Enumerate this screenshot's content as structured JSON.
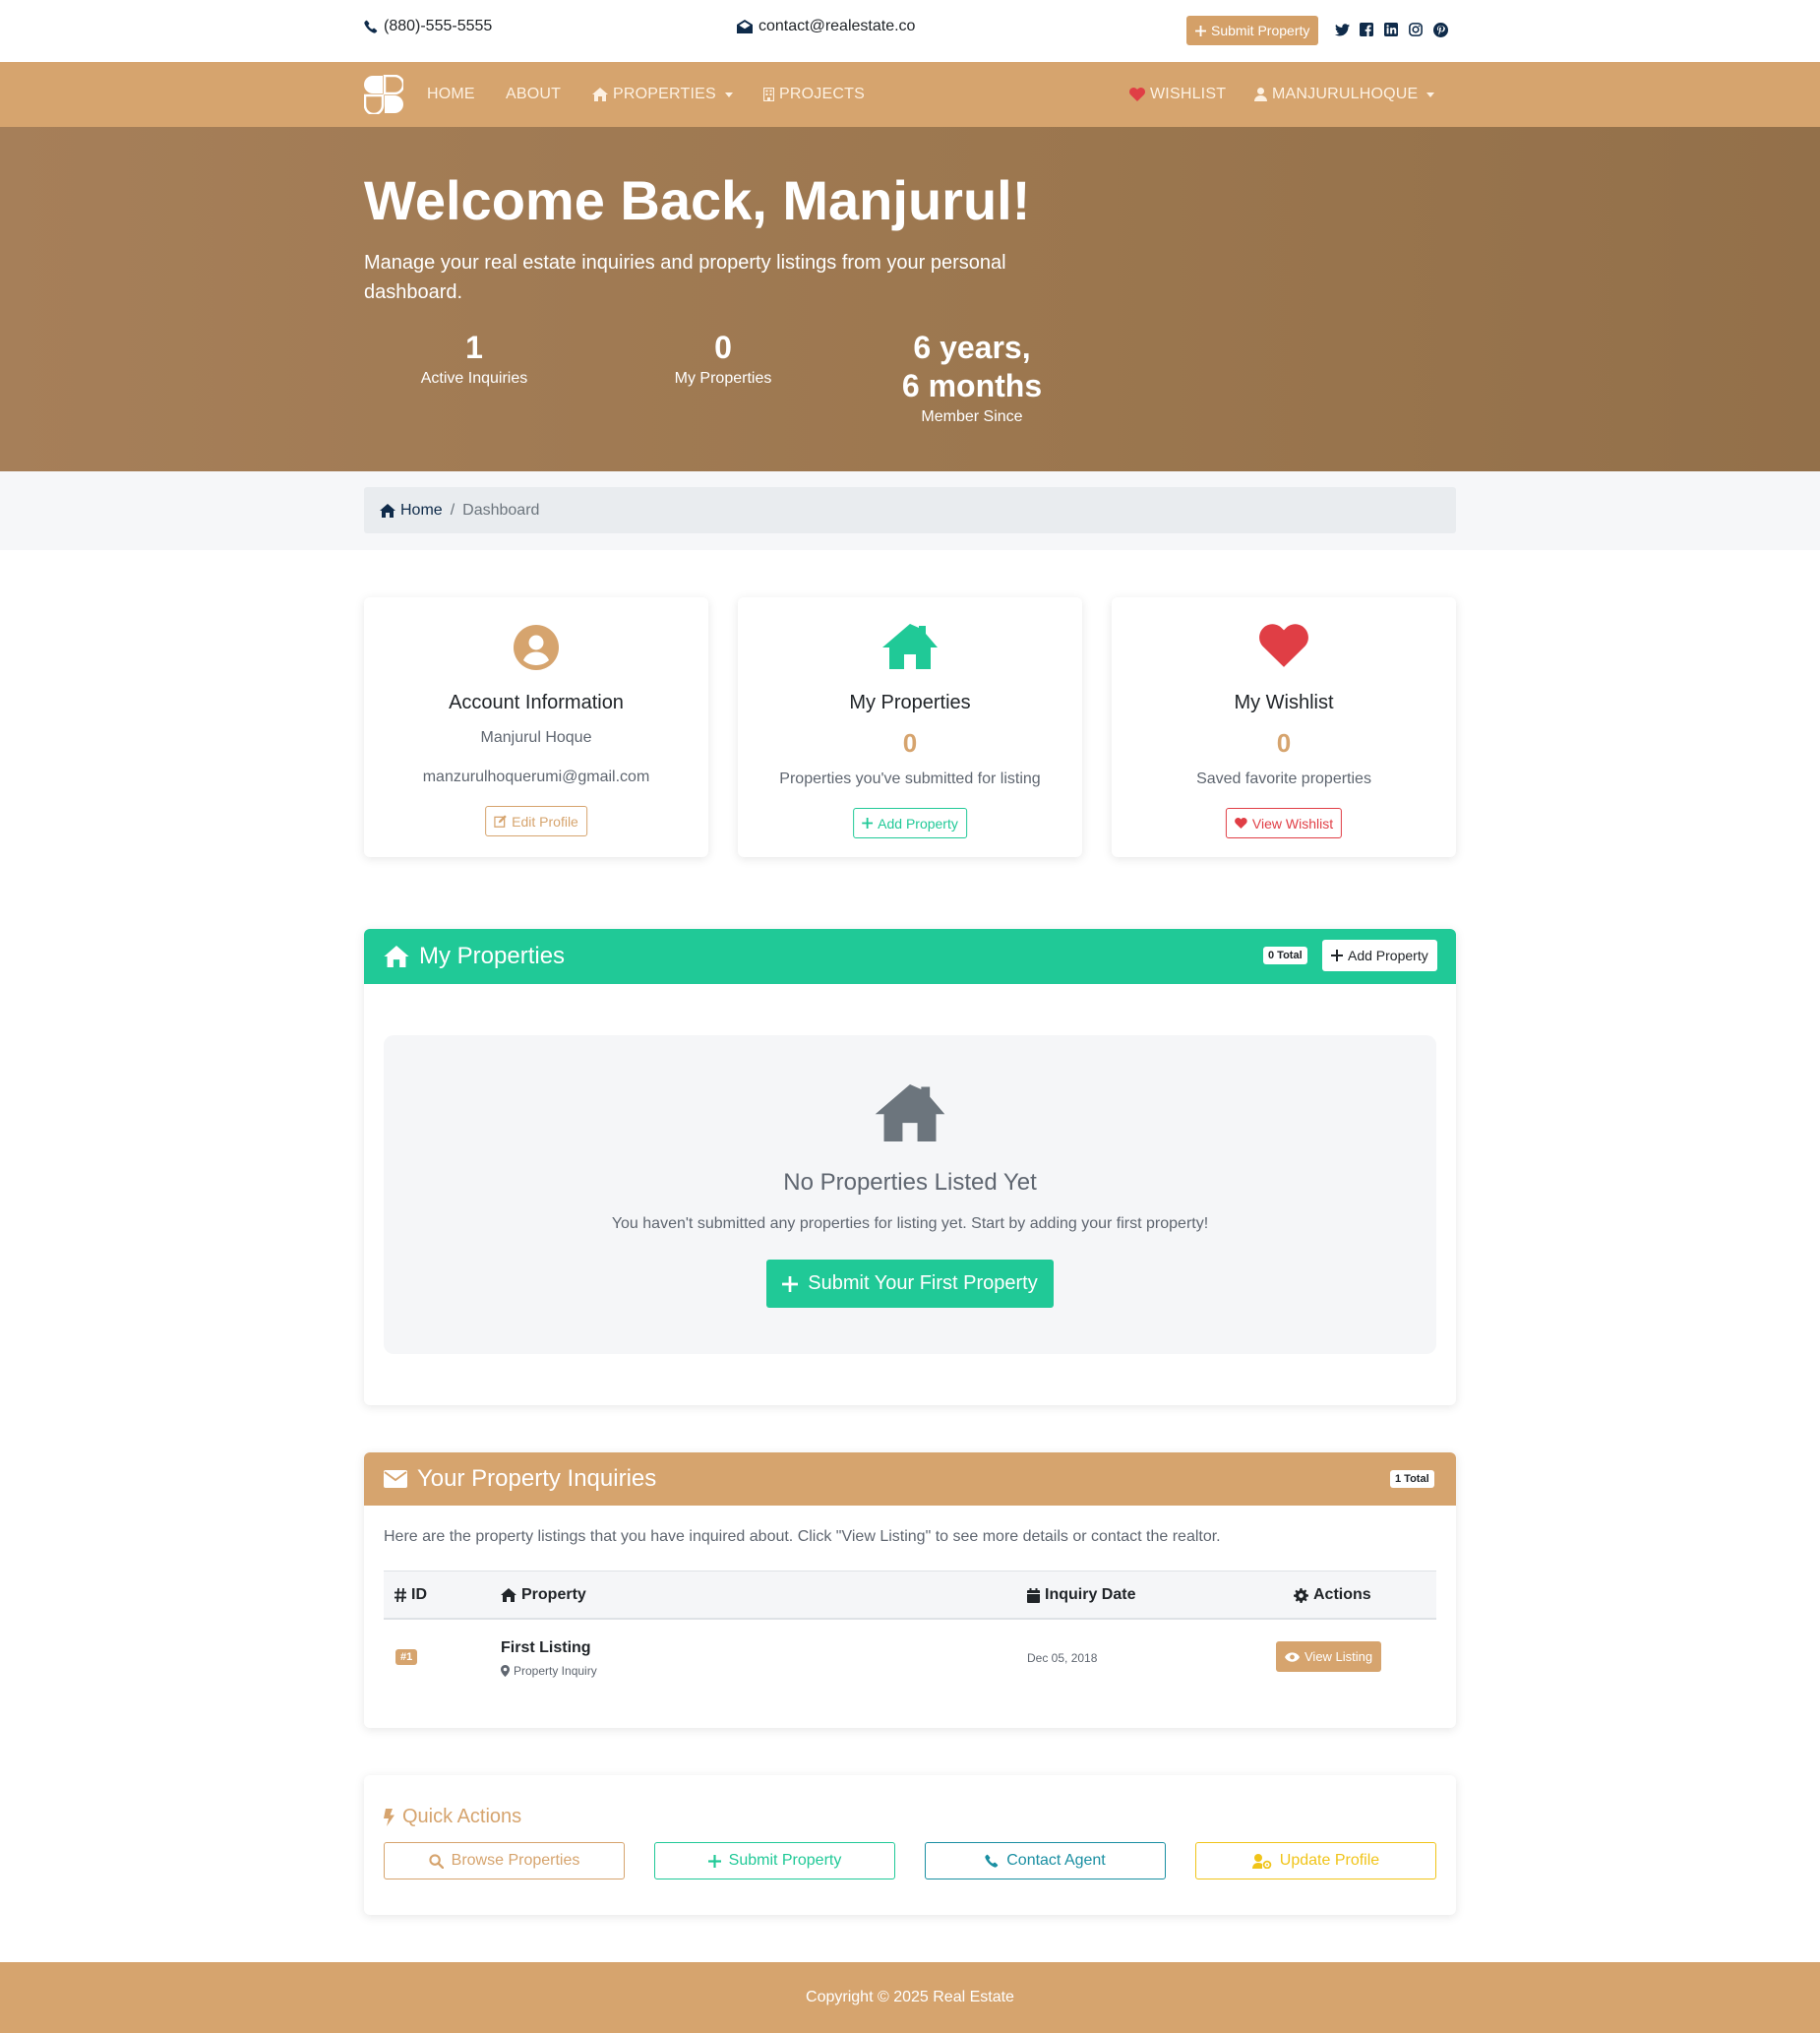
{
  "topbar": {
    "phone": "(880)-555-5555",
    "email": "contact@realestate.co",
    "submit_label": "Submit Property",
    "social_icons": [
      "twitter-icon",
      "facebook-icon",
      "linkedin-icon",
      "instagram-icon",
      "pinterest-icon"
    ]
  },
  "nav": {
    "home": "HOME",
    "about": "ABOUT",
    "properties": "PROPERTIES",
    "projects": "PROJECTS",
    "wishlist": "WISHLIST",
    "user": "MANJURULHOQUE"
  },
  "hero": {
    "title": "Welcome Back, Manjurul!",
    "subtitle": "Manage your real estate inquiries and property listings from your personal dashboard.",
    "stats": [
      {
        "value": "1",
        "label": "Active Inquiries"
      },
      {
        "value": "0",
        "label": "My Properties"
      },
      {
        "value_line1": "6 years,",
        "value_line2": "6 months",
        "label": "Member Since"
      }
    ]
  },
  "breadcrumb": {
    "home": "Home",
    "current": "Dashboard"
  },
  "cards": {
    "account": {
      "title": "Account Information",
      "name": "Manjurul Hoque",
      "email": "manzurulhoquerumi@gmail.com",
      "button": "Edit Profile"
    },
    "properties": {
      "title": "My Properties",
      "count": "0",
      "desc": "Properties you've submitted for listing",
      "button": "Add Property"
    },
    "wishlist": {
      "title": "My Wishlist",
      "count": "0",
      "desc": "Saved favorite properties",
      "button": "View Wishlist"
    }
  },
  "my_properties": {
    "title": "My Properties",
    "total_badge": "0 Total",
    "add_button": "Add Property",
    "empty_title": "No Properties Listed Yet",
    "empty_text": "You haven't submitted any properties for listing yet. Start by adding your first property!",
    "empty_button": "Submit Your First Property"
  },
  "inquiries": {
    "title": "Your Property Inquiries",
    "total_badge": "1 Total",
    "intro": "Here are the property listings that you have inquired about. Click \"View Listing\" to see more details or contact the realtor.",
    "columns": [
      "ID",
      "Property",
      "Inquiry Date",
      "Actions"
    ],
    "rows": [
      {
        "id": "#1",
        "property": "First Listing",
        "sub": "Property Inquiry",
        "date": "Dec 05, 2018",
        "action": "View Listing"
      }
    ]
  },
  "quick_actions": {
    "title": "Quick Actions",
    "buttons": [
      "Browse Properties",
      "Submit Property",
      "Contact Agent",
      "Update Profile"
    ]
  },
  "footer": {
    "text": "Copyright © 2025 Real Estate"
  },
  "colors": {
    "brand": "#d6a46e",
    "hero": "#a07a53",
    "green": "#20c997",
    "danger": "#e03e45",
    "info": "#1a8fa2",
    "warning": "#f0c419",
    "dark_text": "#212529"
  }
}
